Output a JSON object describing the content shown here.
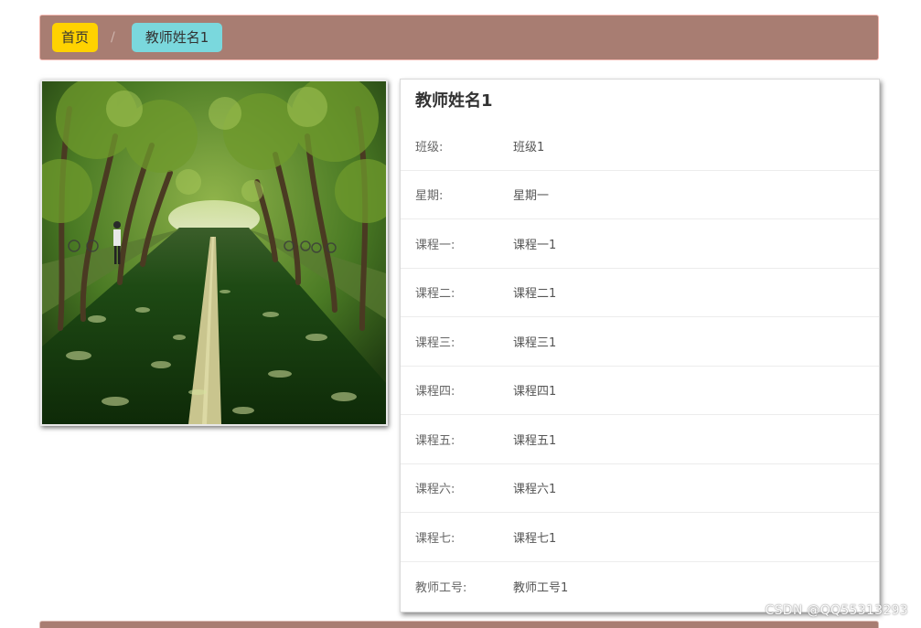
{
  "breadcrumb": {
    "home_label": "首页",
    "separator": "/",
    "current_label": "教师姓名1"
  },
  "teacher": {
    "name": "教师姓名1",
    "rows": [
      {
        "label": "班级:",
        "value": "班级1"
      },
      {
        "label": "星期:",
        "value": "星期一"
      },
      {
        "label": "课程一:",
        "value": "课程一1"
      },
      {
        "label": "课程二:",
        "value": "课程二1"
      },
      {
        "label": "课程三:",
        "value": "课程三1"
      },
      {
        "label": "课程四:",
        "value": "课程四1"
      },
      {
        "label": "课程五:",
        "value": "课程五1"
      },
      {
        "label": "课程六:",
        "value": "课程六1"
      },
      {
        "label": "课程七:",
        "value": "课程七1"
      },
      {
        "label": "教师工号:",
        "value": "教师工号1"
      }
    ]
  },
  "watermark": "CSDN @QQ55313293",
  "colors": {
    "breadcrumb_bg": "#a87d72",
    "home_badge": "#ffd200",
    "current_badge": "#7ad8dd"
  }
}
